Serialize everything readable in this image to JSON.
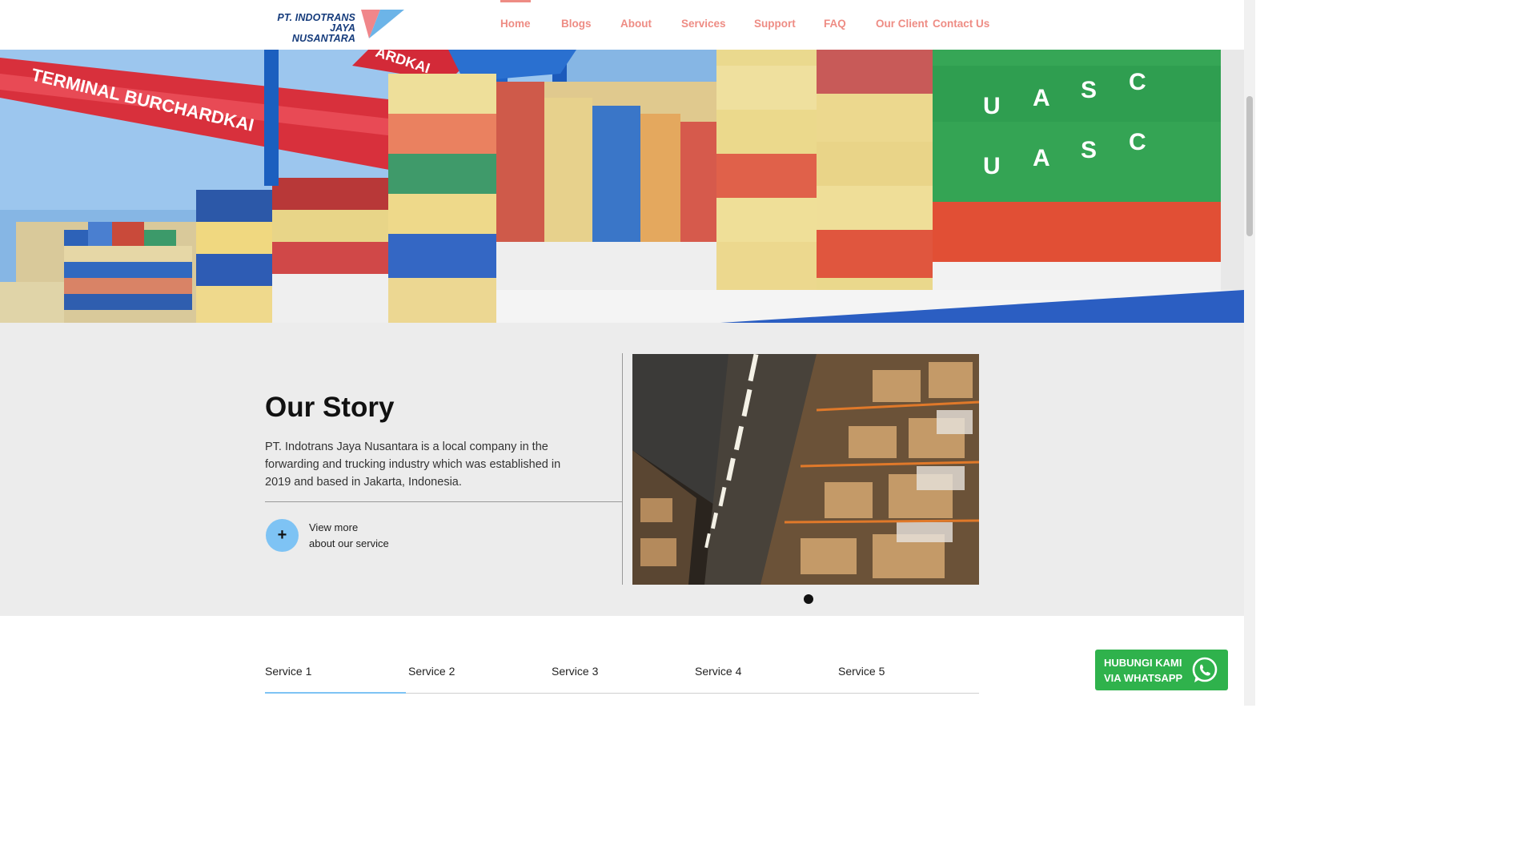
{
  "header": {
    "logo_line1": "PT. INDOTRANS JAYA",
    "logo_line2": "NUSANTARA",
    "nav": [
      {
        "label": "Home",
        "active": true
      },
      {
        "label": "Blogs"
      },
      {
        "label": "About"
      },
      {
        "label": "Services"
      },
      {
        "label": "Support"
      },
      {
        "label": "FAQ"
      },
      {
        "label": "Our Client"
      },
      {
        "label": "Contact Us"
      }
    ]
  },
  "hero": {
    "image": "container-port-terminal-photo",
    "crane_sign_1": "TERMINAL BURCHARDKAI",
    "crane_sign_2": "ARDKAI"
  },
  "story": {
    "title": "Our Story",
    "text": "PT. Indotrans Jaya Nusantara is a local company in the forwarding and trucking industry which was established in 2019 and based in Jakarta, Indonesia.",
    "view_more_line1": "View more",
    "view_more_line2": "about our service",
    "plus": "+",
    "image": "warehouse-shelves-photo"
  },
  "services": {
    "tabs": [
      "Service 1",
      "Service 2",
      "Service 3",
      "Service 4",
      "Service 5"
    ],
    "active_tab": 0
  },
  "whatsapp": {
    "line1": "HUBUNGI KAMI",
    "line2": "VIA WHATSAPP",
    "icon": "whatsapp-icon"
  },
  "colors": {
    "nav": "#ee8c84",
    "logo_navy": "#163c7c",
    "accent_blue": "#7ec3f4",
    "whatsapp_green": "#2fb24c",
    "section_bg": "#ececec"
  }
}
